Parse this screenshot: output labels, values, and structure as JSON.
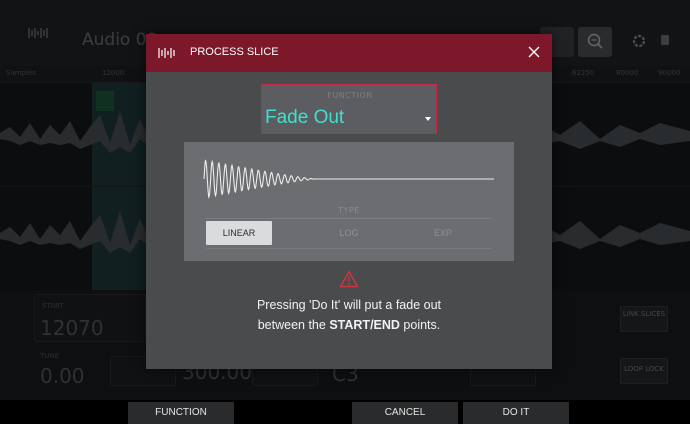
{
  "app": {
    "title": "Audio 00",
    "ruler_labels": [
      "Samples",
      "12000",
      "62250",
      "80000",
      "90000"
    ]
  },
  "background_panel": {
    "start_label": "START",
    "start_value": "12070",
    "tune_label": "TUNE",
    "tune_value": "0.00",
    "bpm_value": "300.00",
    "root_value": "C3",
    "link_slices_label": "LINK SLICES",
    "loop_lock_label": "LOOP LOCK"
  },
  "modal": {
    "title": "PROCESS SLICE",
    "close_icon": "close-icon",
    "function": {
      "label": "FUNCTION",
      "value": "Fade Out"
    },
    "type": {
      "label": "TYPE",
      "options": [
        "LINEAR",
        "LOG",
        "EXP"
      ],
      "selected": "LINEAR"
    },
    "message": {
      "line1": "Pressing 'Do It' will put a fade out",
      "line2_prefix": "between the ",
      "start": "START",
      "separator": "/",
      "end": "END",
      "line2_suffix": " points."
    }
  },
  "footer": {
    "function_label": "FUNCTION",
    "cancel_label": "CANCEL",
    "do_it_label": "DO IT"
  },
  "colors": {
    "accent_red": "#7c1829",
    "accent_teal": "#3fe0cf",
    "warning_red": "#d2353f"
  }
}
